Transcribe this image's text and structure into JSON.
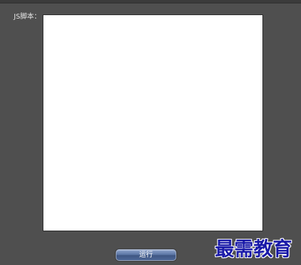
{
  "form": {
    "script_label": "JS脚本：",
    "script_value": "",
    "run_label": "运行"
  },
  "watermark": {
    "text": "最需教育"
  },
  "colors": {
    "background": "#4e4e4e",
    "editor_background": "#ffffff",
    "button_blue": "#5d77a6",
    "watermark_blue": "#1a1aa8"
  }
}
